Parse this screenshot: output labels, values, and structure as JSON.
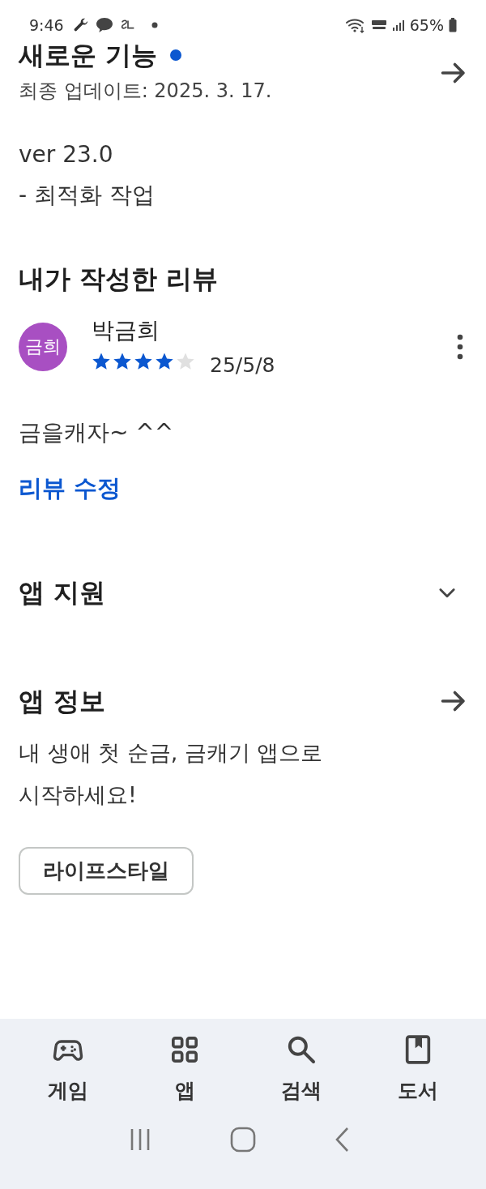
{
  "status_bar": {
    "time": "9:46",
    "battery": "65%"
  },
  "whats_new": {
    "title": "새로운 기능",
    "new_badge": true,
    "updated": "최종 업데이트: 2025. 3. 17.",
    "notes": [
      "ver 23.0",
      "- 최적화 작업"
    ]
  },
  "my_review": {
    "heading": "내가 작성한 리뷰",
    "author": {
      "name": "박금희",
      "initials": "금희",
      "color": "#a84fc2"
    },
    "stars": 4,
    "date": "25/5/8",
    "text": "금을캐자~ ^^",
    "edit_link": "리뷰 수정"
  },
  "app_support": {
    "title": "앱 지원",
    "expanded": false
  },
  "app_info": {
    "title": "앱 정보",
    "description": "내 생애 첫 순금, 금캐기 앱으로 시작하세요!",
    "category": "라이프스타일"
  },
  "bottom_nav": [
    {
      "label": "게임"
    },
    {
      "label": "앱"
    },
    {
      "label": "검색"
    },
    {
      "label": "도서"
    }
  ]
}
